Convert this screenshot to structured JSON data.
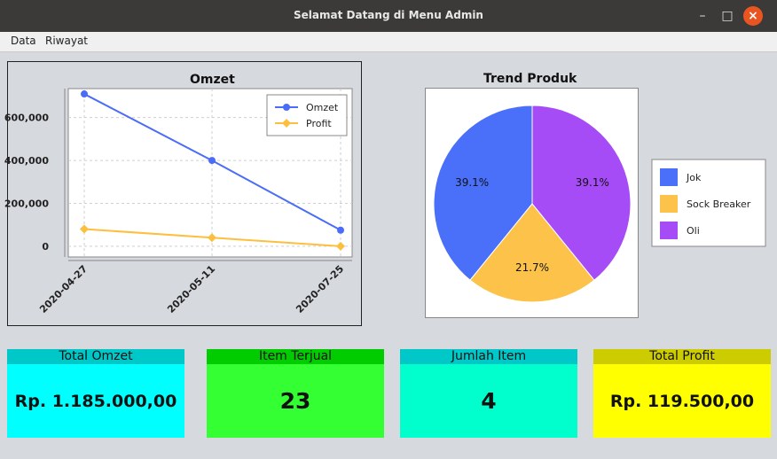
{
  "window": {
    "title": "Selamat Datang di Menu Admin",
    "min_glyph": "–",
    "max_glyph": "□",
    "close_glyph": "×"
  },
  "menu": [
    {
      "label": "Data"
    },
    {
      "label": "Riwayat"
    }
  ],
  "colors": {
    "omzet": "#4a6cf7",
    "profit": "#fcbf3e",
    "jok": "#4a6ff9",
    "sock_breaker": "#fcc24a",
    "oli": "#a64cf7"
  },
  "chart_data": [
    {
      "type": "line",
      "title": "Omzet",
      "categories": [
        "2020-04-27",
        "2020-05-11",
        "2020-07-25"
      ],
      "series": [
        {
          "name": "Omzet",
          "values": [
            710000,
            400000,
            75000
          ]
        },
        {
          "name": "Profit",
          "values": [
            80000,
            40000,
            0
          ]
        }
      ],
      "yticks": [
        "0",
        "200,000",
        "400,000",
        "600,000"
      ],
      "ylim": [
        -50000,
        735000
      ],
      "grid": true,
      "legend": "top-right"
    },
    {
      "type": "pie",
      "title": "Trend Produk",
      "slices": [
        {
          "name": "Jok",
          "value": 39.1,
          "label": "39.1%"
        },
        {
          "name": "Sock Breaker",
          "value": 21.7,
          "label": "21.7%"
        },
        {
          "name": "Oli",
          "value": 39.1,
          "label": "39.1%"
        }
      ],
      "legend": "right"
    }
  ],
  "stats": [
    {
      "label": "Total Omzet",
      "value": "Rp. 1.185.000,00",
      "head_color": "#00c8c8",
      "body_color": "#00ffff"
    },
    {
      "label": "Item Terjual",
      "value": "23",
      "head_color": "#00cc00",
      "body_color": "#33ff33"
    },
    {
      "label": "Jumlah Item",
      "value": "4",
      "head_color": "#00c8c8",
      "body_color": "#00ffcc"
    },
    {
      "label": "Total Profit",
      "value": "Rp. 119.500,00",
      "head_color": "#cccc00",
      "body_color": "#ffff00"
    }
  ]
}
